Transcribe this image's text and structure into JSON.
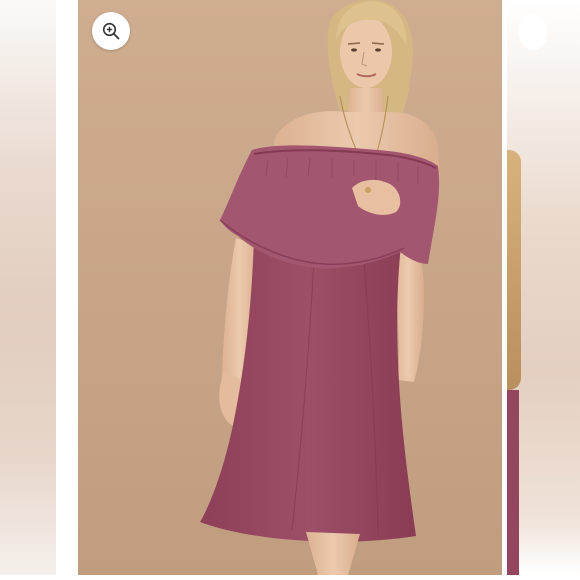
{
  "gallery": {
    "zoom_button": {
      "icon": "zoom-in-icon"
    },
    "colors": {
      "backdrop": "#c9a688",
      "dress": "#9a4c65",
      "skin": "#e7c3a6",
      "hair": "#dcc18f"
    }
  }
}
